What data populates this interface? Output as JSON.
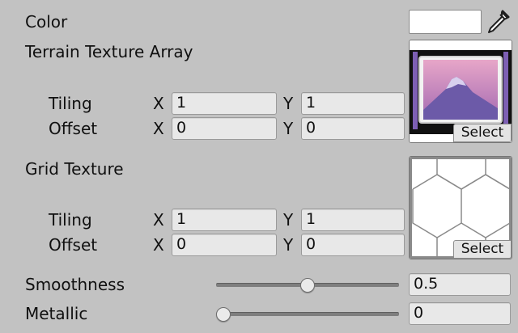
{
  "color": {
    "label": "Color",
    "value": "#ffffff",
    "picker_icon": "eyedropper-icon"
  },
  "terrain": {
    "label": "Terrain Texture Array",
    "tiling_label": "Tiling",
    "offset_label": "Offset",
    "tiling_x": "1",
    "tiling_y": "1",
    "offset_x": "0",
    "offset_y": "0",
    "select_label": "Select"
  },
  "grid": {
    "label": "Grid Texture",
    "tiling_label": "Tiling",
    "offset_label": "Offset",
    "tiling_x": "1",
    "tiling_y": "1",
    "offset_x": "0",
    "offset_y": "0",
    "select_label": "Select"
  },
  "axes": {
    "x": "X",
    "y": "Y"
  },
  "smoothness": {
    "label": "Smoothness",
    "value": "0.5",
    "fraction": 0.5
  },
  "metallic": {
    "label": "Metallic",
    "value": "0",
    "fraction": 0
  }
}
